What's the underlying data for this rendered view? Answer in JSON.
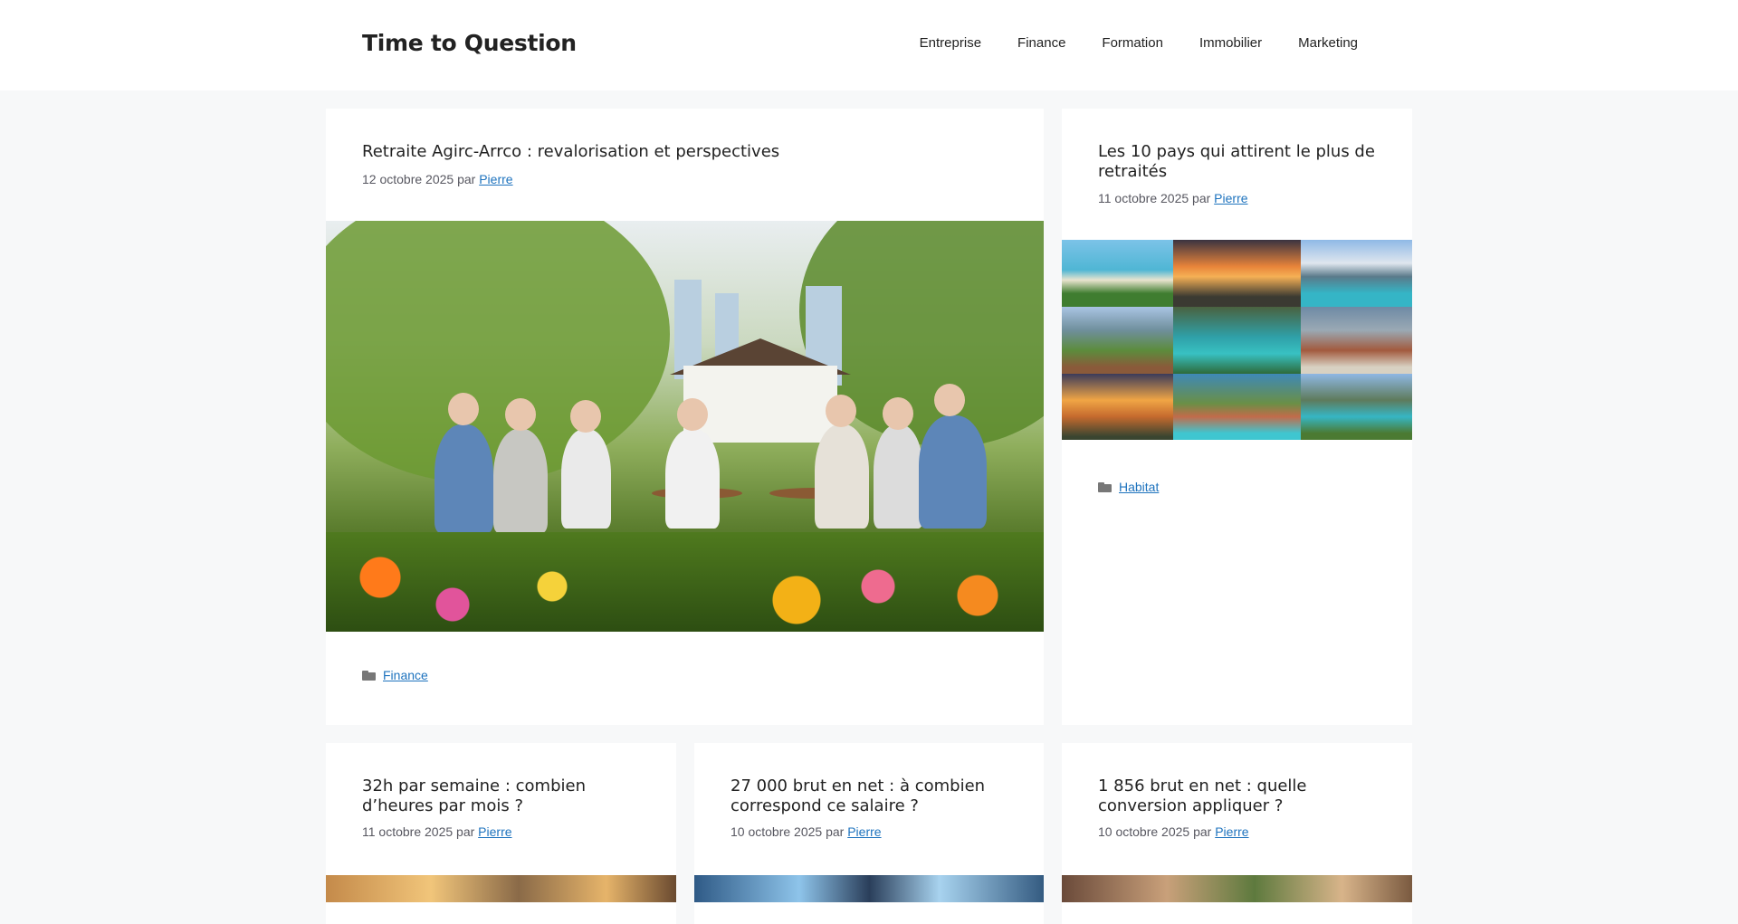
{
  "site": {
    "title": "Time to Question"
  },
  "nav": [
    "Entreprise",
    "Finance",
    "Formation",
    "Immobilier",
    "Marketing"
  ],
  "posts": [
    {
      "title": "Retraite Agirc-Arrco : revalorisation et perspectives",
      "date": "12 octobre 2025",
      "by": "par",
      "author": "Pierre",
      "category": "Finance"
    },
    {
      "title": "Les 10 pays qui attirent le plus de retraités",
      "date": "11 octobre 2025",
      "by": "par",
      "author": "Pierre",
      "category": "Habitat"
    },
    {
      "title": "32h par semaine : combien d’heures par mois ?",
      "date": "11 octobre 2025",
      "by": "par",
      "author": "Pierre"
    },
    {
      "title": "27 000 brut en net : à combien correspond ce salaire ?",
      "date": "10 octobre 2025",
      "by": "par",
      "author": "Pierre"
    },
    {
      "title": "1 856 brut en net : quelle conversion appliquer ?",
      "date": "10 octobre 2025",
      "by": "par",
      "author": "Pierre"
    }
  ],
  "icons": {
    "category": "folder-icon"
  }
}
